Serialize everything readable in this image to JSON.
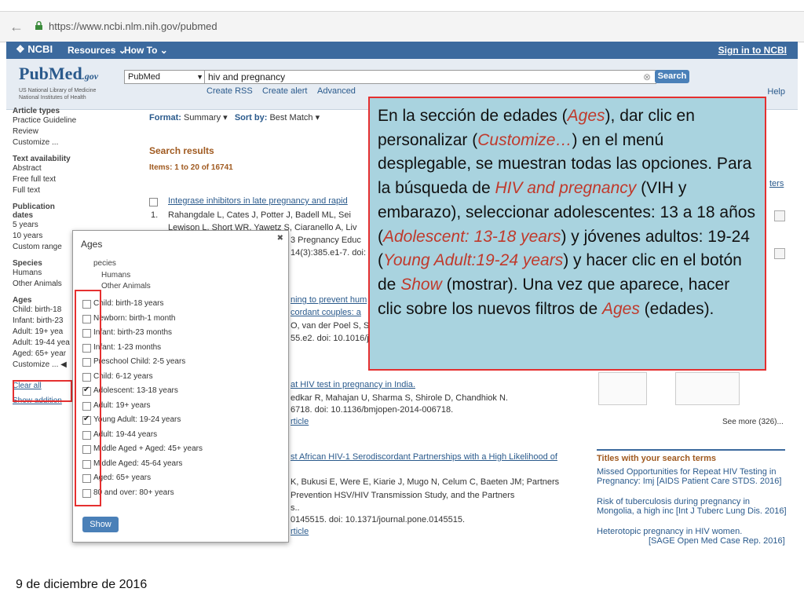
{
  "browser": {
    "url": "https://www.ncbi.nlm.nih.gov/pubmed"
  },
  "ncbi_bar": {
    "logo": "NCBI",
    "resources": "Resources",
    "howto": "How To",
    "signin": "Sign in to NCBI"
  },
  "header": {
    "logo": "PubMed",
    "logo_suffix": ".gov",
    "subtitle1": "US National Library of Medicine",
    "subtitle2": "National Institutes of Health",
    "db": "PubMed",
    "query": "hiv and pregnancy",
    "search_label": "Search",
    "rss": "Create RSS",
    "alert": "Create alert",
    "advanced": "Advanced",
    "help": "Help"
  },
  "sidebar": {
    "article_types": "Article types",
    "at_items": [
      "Practice Guideline",
      "Review",
      "Customize ..."
    ],
    "text_availability": "Text availability",
    "ta_items": [
      "Abstract",
      "Free full text",
      "Full text"
    ],
    "pub_dates": "Publication dates",
    "pd_items": [
      "5 years",
      "10 years",
      "Custom range"
    ],
    "species": "Species",
    "sp_items": [
      "Humans",
      "Other Animals"
    ],
    "ages": "Ages",
    "age_items": [
      "Child: birth-18",
      "Infant: birth-23",
      "Adult: 19+ yea",
      "Adult: 19-44 yea",
      "Aged: 65+ year"
    ],
    "customize": "Customize ...",
    "clear_all": "Clear all",
    "show_additional": "Show addition"
  },
  "main": {
    "format_label": "Format:",
    "format_value": "Summary",
    "sort_label": "Sort by:",
    "sort_value": "Best Match",
    "results_title": "Search results",
    "items": "Items: 1 to 20 of 16741",
    "r1_title": "Integrase inhibitors in late pregnancy and rapid",
    "r1_num": "1.",
    "r1_authors": "Rahangdale L, Cates J, Potter J, Badell ML, Sei",
    "r1_authors2": "Lewison L, Short WR, Yawetz S, Ciaranello A, Liv",
    "r1_pregnancy": "3 Pregnancy Educ",
    "r1_doi": "14(3):385.e1-7. doi: 10",
    "r2_title": "ning to prevent hum",
    "r2_line2": "cordant couples: a",
    "r2_line3": "O, van der Poel S, S",
    "r2_doi": "55.e2. doi: 10.1016/j.f",
    "r3_title": "at HIV test in pregnancy in India.",
    "r3_authors": "edkar R, Mahajan U, Sharma S, Shirole D, Chandhiok N.",
    "r3_doi": "6718. doi: 10.1136/bmjopen-2014-006718.",
    "r3_article": "rticle",
    "r4_title": "st African HIV-1 Serodiscordant Partnerships with a High Likelihood of",
    "r4_authors": "K, Bukusi E, Were E, Kiarie J, Mugo N, Celum C, Baeten JM; Partners",
    "r4_line3": "Prevention HSV/HIV Transmission Study, and the Partners",
    "r4_line4": "s..",
    "r4_doi": "0145515. doi: 10.1371/journal.pone.0145515.",
    "r4_article": "rticle"
  },
  "ages_popup": {
    "title": "Ages",
    "close": "✖",
    "species": "pecies",
    "humans": "Humans",
    "other": "Other Animals",
    "options": [
      {
        "label": "Child: birth-18 years",
        "checked": false
      },
      {
        "label": "Newborn: birth-1 month",
        "checked": false
      },
      {
        "label": "Infant: birth-23 months",
        "checked": false
      },
      {
        "label": "Infant: 1-23 months",
        "checked": false
      },
      {
        "label": "Preschool Child: 2-5 years",
        "checked": false
      },
      {
        "label": "Child: 6-12 years",
        "checked": false
      },
      {
        "label": "Adolescent: 13-18 years",
        "checked": true
      },
      {
        "label": "Adult: 19+ years",
        "checked": false
      },
      {
        "label": "Young Adult: 19-24 years",
        "checked": true
      },
      {
        "label": "Adult: 19-44 years",
        "checked": false
      },
      {
        "label": "Middle Aged + Aged: 45+ years",
        "checked": false
      },
      {
        "label": "Middle Aged: 45-64 years",
        "checked": false
      },
      {
        "label": "Aged: 65+ years",
        "checked": false
      },
      {
        "label": "80 and over: 80+ years",
        "checked": false
      }
    ],
    "show": "Show"
  },
  "right": {
    "filters_link": "ters",
    "see_more": "See more (326)...",
    "titles_head": "Titles with your search terms",
    "t1a": "Missed Opportunities for Repeat HIV Testing in",
    "t1b": "Pregnancy: Imj [AIDS Patient Care STDS. 2016]",
    "t2a": "Risk of tuberculosis during pregnancy in",
    "t2b": "Mongolia, a high inc [Int J Tuberc Lung Dis. 2016]",
    "t3a": "Heterotopic pregnancy in HIV women.",
    "t3b": "[SAGE Open Med Case Rep. 2016]"
  },
  "callout": {
    "p1": "En la sección de edades (",
    "i1": "Ages",
    "p2": "), dar clic en personalizar (",
    "i2": "Customize…",
    "p3": ") en el menú desplegable, se muestran todas las opciones. Para la búsqueda de ",
    "i3": "HIV and pregnancy",
    "p4": " (VIH y embarazo), seleccionar adolescentes: 13 a 18 años (",
    "i4": "Adolescent: 13-18 years",
    "p5": ") y jóvenes adultos: 19-24 (",
    "i5": "Young Adult:19-24 years",
    "p6": ") y hacer clic en el botón de ",
    "i6": "Show",
    "p7": " (mostrar). Una vez que aparece, hacer clic sobre los nuevos filtros de ",
    "i7": "Ages",
    "p8": " (edades)."
  },
  "footer": {
    "date": "9 de diciembre de 2016"
  },
  "colors": {
    "ncbi_blue": "#3c6a9e",
    "highlight_red": "#e53030",
    "callout_bg": "#a9d3df"
  }
}
